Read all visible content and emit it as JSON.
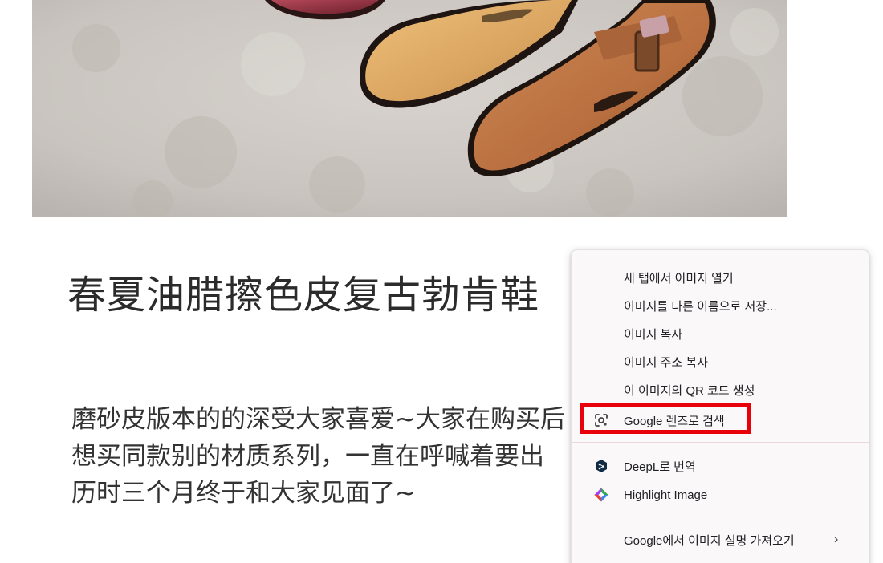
{
  "article": {
    "title": "春夏油腊擦色皮复古勃肯鞋",
    "body_lines": [
      "磨砂皮版本的的深受大家喜爱~大家在购买后",
      "想买同款别的材质系列，一直在呼喊着要出",
      "历时三个月终于和大家见面了~"
    ]
  },
  "context_menu": {
    "items": [
      {
        "label": "새 탭에서 이미지 열기"
      },
      {
        "label": "이미지를 다른 이름으로 저장..."
      },
      {
        "label": "이미지 복사"
      },
      {
        "label": "이미지 주소 복사"
      },
      {
        "label": "이 이미지의 QR 코드 생성"
      },
      {
        "label": "Google 렌즈로 검색",
        "icon": "google-lens-icon"
      },
      {
        "label": "DeepL로 번역",
        "icon": "deepl-icon"
      },
      {
        "label": "Highlight Image",
        "icon": "highlight-image-icon"
      },
      {
        "label": "Google에서 이미지 설명 가져오기",
        "icon": "chevron-right-icon"
      }
    ]
  },
  "colors": {
    "highlight": "#e8000b",
    "menu_bg": "#fbf8fa",
    "text": "#202124"
  }
}
